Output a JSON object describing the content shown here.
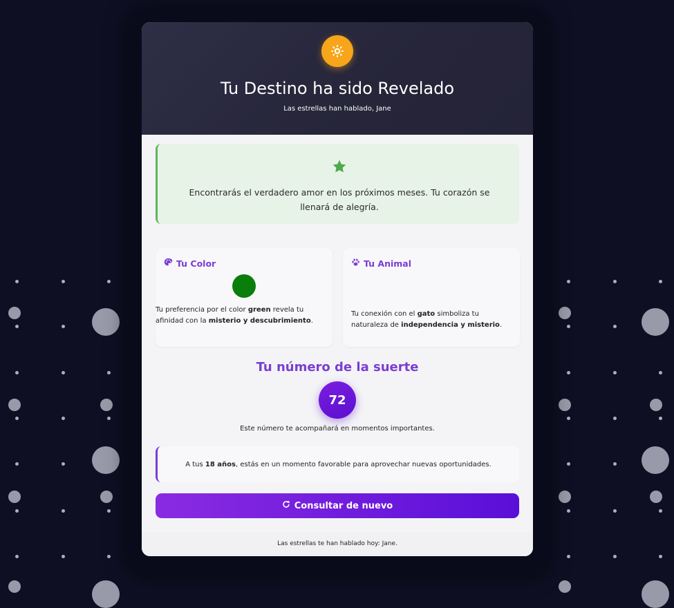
{
  "header": {
    "icon": "sun-icon",
    "title": "Tu Destino ha sido Revelado",
    "subtitle": "Las estrellas han hablado, Jane"
  },
  "fortune": {
    "icon": "star-icon",
    "text": "Encontrarás el verdadero amor en los próximos meses. Tu corazón se llenará de alegría."
  },
  "color_box": {
    "icon": "palette-icon",
    "title": "Tu Color",
    "swatch": "#0a7e0a",
    "desc_prefix": "Tu preferencia por el color ",
    "color_name": "green",
    "desc_mid": " revela tu afinidad con la ",
    "trait": "misterio y descubrimiento",
    "desc_suffix": "."
  },
  "animal_box": {
    "icon": "paw-icon",
    "title": "Tu Animal",
    "desc_prefix": "Tu conexión con el ",
    "animal": "gato",
    "desc_mid": " simboliza tu naturaleza de ",
    "trait": "independencia y misterio",
    "desc_suffix": "."
  },
  "lucky": {
    "title": "Tu número de la suerte",
    "number": "72",
    "note": "Este número te acompañará en momentos importantes."
  },
  "age": {
    "prefix": "A tus ",
    "age_text": "18 años",
    "suffix": ", estás en un momento favorable para aprovechar nuevas oportunidades."
  },
  "button": {
    "icon": "redo-icon",
    "label": "Consultar de nuevo"
  },
  "footer": {
    "text": "Las estrellas te han hablado hoy: Jane."
  },
  "colors": {
    "background": "#0e0f23",
    "accent": "#7b3dd3",
    "sun": "#f7a51b",
    "fortune_border": "#5fb55f"
  }
}
